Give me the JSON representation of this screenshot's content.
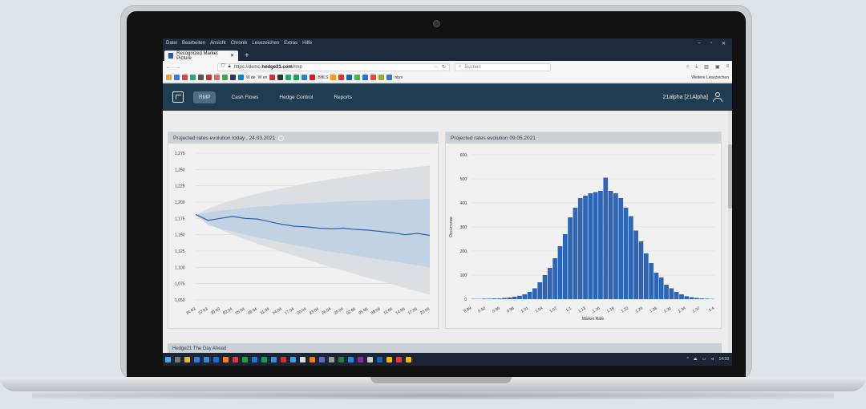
{
  "browser": {
    "menu": [
      "Datei",
      "Bearbeiten",
      "Ansicht",
      "Chronik",
      "Lesezeichen",
      "Extras",
      "Hilfe"
    ],
    "window_controls": [
      "–",
      "▫",
      "✕"
    ],
    "tab_title": "Recognized Market Picture",
    "tab_close": "✕",
    "new_tab": "+",
    "url_prefix": "https://demo.",
    "url_domain": "hedge21.com",
    "url_path": "/rmp",
    "search_placeholder": "Suchen",
    "bookmarks_more": "Weitere Lesezeichen",
    "bookmarks_text": [
      "W de",
      "W en",
      "BHLS",
      "hbrs"
    ]
  },
  "app": {
    "nav": [
      "RMP",
      "Cash Flows",
      "Hedge Control",
      "Reports"
    ],
    "user": "21alpha [21Alpha]"
  },
  "panels": {
    "left_title": "Projected rates evolution today , 24.03.2021",
    "right_title": "Projected rates evolution 09.05.2021",
    "lower_title": "Hedge21 The Day Ahead"
  },
  "taskbar": {
    "clock": "14:33",
    "tray": [
      "^",
      "⏏",
      "▭",
      "⊲"
    ]
  },
  "chart_data": [
    {
      "type": "line",
      "title": "Projected rates evolution today , 24.03.2021",
      "x": [
        "24.03",
        "27.03",
        "30.03",
        "02.04",
        "05.04",
        "08.04",
        "11.04",
        "14.04",
        "17.04",
        "20.04",
        "23.04",
        "26.04",
        "29.04",
        "02.05",
        "05.05",
        "08.05",
        "11.05",
        "14.05",
        "17.05",
        "20.05"
      ],
      "ylim": [
        1.05,
        1.275
      ],
      "yticks": [
        "1,275",
        "1,250",
        "1,225",
        "1,200",
        "1,175",
        "1,150",
        "1,125",
        "1,100",
        "1,075",
        "1,050"
      ],
      "series": [
        {
          "values": [
            1.181,
            1.172,
            1.175,
            1.178,
            1.175,
            1.174,
            1.17,
            1.166,
            1.163,
            1.162,
            1.16,
            1.159,
            1.16,
            1.158,
            1.157,
            1.155,
            1.153,
            1.15,
            1.152,
            1.149
          ]
        }
      ],
      "bands": {
        "outer_upper": [
          1.181,
          1.19,
          1.197,
          1.203,
          1.208,
          1.213,
          1.217,
          1.221,
          1.225,
          1.229,
          1.232,
          1.235,
          1.238,
          1.241,
          1.244,
          1.247,
          1.249,
          1.252,
          1.254,
          1.256
        ],
        "outer_lower": [
          1.181,
          1.168,
          1.158,
          1.15,
          1.143,
          1.136,
          1.13,
          1.124,
          1.118,
          1.112,
          1.106,
          1.1,
          1.095,
          1.089,
          1.084,
          1.079,
          1.074,
          1.068,
          1.063,
          1.058
        ],
        "inner_upper": [
          1.181,
          1.184,
          1.187,
          1.189,
          1.191,
          1.193,
          1.194,
          1.196,
          1.197,
          1.198,
          1.199,
          1.2,
          1.201,
          1.202,
          1.202,
          1.203,
          1.203,
          1.204,
          1.204,
          1.205
        ],
        "inner_lower": [
          1.181,
          1.165,
          1.159,
          1.155,
          1.15,
          1.146,
          1.142,
          1.138,
          1.134,
          1.131,
          1.127,
          1.124,
          1.121,
          1.118,
          1.115,
          1.112,
          1.109,
          1.106,
          1.103,
          1.1
        ]
      },
      "colors": {
        "line": "#2f5fb0",
        "outer_band": "#d8dde2",
        "inner_band": "#b8cfe2"
      }
    },
    {
      "type": "bar",
      "title": "Projected rates evolution 09.05.2021",
      "xlabel": "Market Rate",
      "ylabel": "Occurrence",
      "ylim": [
        0,
        600
      ],
      "yticks": [
        "600",
        "500",
        "400",
        "300",
        "200",
        "100",
        "0"
      ],
      "xticks": [
        "0.89",
        "0.92",
        "0.95",
        "0.98",
        "1.01",
        "1.04",
        "1.07",
        "1.1",
        "1.13",
        "1.16",
        "1.19",
        "1.22",
        "1.25",
        "1.28",
        "1.31",
        "1.34",
        "1.37",
        "1.4"
      ],
      "values": [
        1,
        1,
        2,
        2,
        3,
        3,
        5,
        7,
        10,
        14,
        20,
        30,
        45,
        70,
        100,
        130,
        170,
        220,
        270,
        340,
        380,
        420,
        430,
        440,
        445,
        450,
        505,
        450,
        440,
        420,
        380,
        345,
        285,
        240,
        190,
        150,
        110,
        90,
        60,
        45,
        30,
        20,
        12,
        8,
        5,
        3,
        2,
        1
      ],
      "colors": {
        "bar": "#2f65b5"
      }
    }
  ]
}
